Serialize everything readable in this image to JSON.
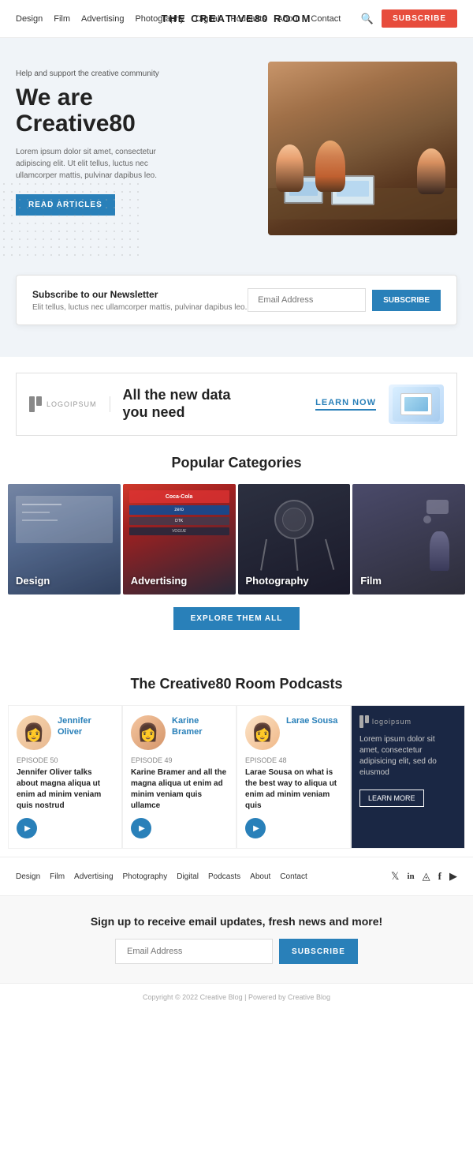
{
  "site": {
    "title": "THE CREATIVE80 ROOM"
  },
  "nav": {
    "links": [
      "Design",
      "Film",
      "Advertising",
      "Photography",
      "Digital",
      "Podcasts",
      "About",
      "Contact"
    ],
    "subscribe_label": "SUBSCRIBE"
  },
  "hero": {
    "tag": "Help and support the creative community",
    "title_line1": "We are",
    "title_line2": "Creative80",
    "description": "Lorem ipsum dolor sit amet, consectetur adipiscing elit. Ut elit tellus, luctus nec ullamcorper mattis, pulvinar dapibus leo.",
    "cta_label": "READ ARTICLES"
  },
  "newsletter": {
    "title": "Subscribe to our Newsletter",
    "description": "Elit tellus, luctus nec ullamcorper mattis, pulvinar dapibus leo.",
    "input_placeholder": "Email Address",
    "button_label": "SUBSCRIBE"
  },
  "ad_banner": {
    "logo_text": "LOGOIPSUM",
    "headline_line1": "All the new data",
    "headline_line2": "you need",
    "cta_label": "LEARN NOW"
  },
  "popular_categories": {
    "title": "Popular Categories",
    "items": [
      {
        "name": "Design",
        "type": "design"
      },
      {
        "name": "Advertising",
        "type": "advert"
      },
      {
        "name": "Photography",
        "type": "photo"
      },
      {
        "name": "Film",
        "type": "film"
      }
    ],
    "explore_label": "EXPLORE THEM ALL"
  },
  "podcasts": {
    "title": "The Creative80 Room Podcasts",
    "items": [
      {
        "name": "Jennifer Oliver",
        "episode": "EPISODE 50",
        "description": "Jennifer Oliver talks about magna aliqua ut enim ad minim veniam quis nostrud",
        "avatar_type": "jennifer"
      },
      {
        "name": "Karine Bramer",
        "episode": "EPISODE 49",
        "description": "Karine Bramer and all the magna aliqua ut enim ad minim veniam quis ullamce",
        "avatar_type": "karine"
      },
      {
        "name": "Larae Sousa",
        "episode": "EPISODE 48",
        "description": "Larae Sousa on what is the best way to aliqua ut enim ad minim veniam quis",
        "avatar_type": "larae"
      },
      {
        "name": "logoipsum",
        "dark": true,
        "description": "Lorem ipsum dolor sit amet, consectetur adipisicing elit, sed do eiusmod",
        "learn_more": "LEARN MORE"
      }
    ]
  },
  "footer": {
    "links": [
      "Design",
      "Film",
      "Advertising",
      "Photography",
      "Digital",
      "Podcasts",
      "About",
      "Contact"
    ],
    "social_icons": [
      "twitter",
      "linkedin",
      "instagram",
      "facebook",
      "youtube"
    ],
    "signup_title": "Sign up to receive email updates, fresh news and more!",
    "email_placeholder": "Email Address",
    "subscribe_label": "SUBSCRIBE",
    "copyright": "Copyright © 2022 Creative Blog | Powered by Creative Blog"
  }
}
